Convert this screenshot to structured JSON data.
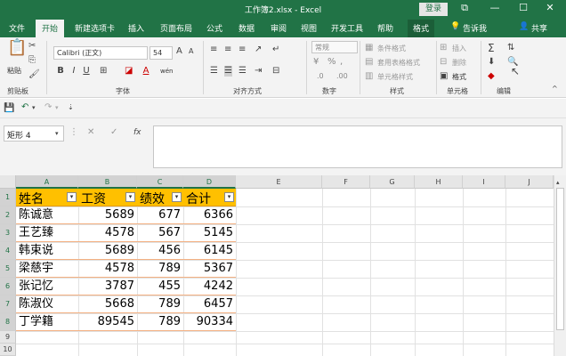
{
  "window": {
    "title": "工作簿2.xlsx  -  Excel",
    "login_label": "登录",
    "restore_glyph": "⧉",
    "minimize_glyph": "—",
    "maximize_glyph": "☐",
    "close_glyph": "✕"
  },
  "tabs": {
    "file": "文件",
    "home": "开始",
    "new_tab": "新建选项卡",
    "insert": "插入",
    "page_layout": "页面布局",
    "formulas": "公式",
    "data": "数据",
    "review": "审阅",
    "view": "视图",
    "developer": "开发工具",
    "help": "帮助",
    "format": "格式",
    "tell_me": "告诉我",
    "share": "共享"
  },
  "ribbon": {
    "paste_label": "粘贴",
    "clipboard_label": "剪贴板",
    "font_name": "Calibri (正文)",
    "font_size": "54",
    "font_group_label": "字体",
    "bold": "B",
    "italic": "I",
    "underline": "U",
    "wen": "wén",
    "alignment_label": "对齐方式",
    "number_format": "常规",
    "number_label": "数字",
    "percent": "%",
    "comma": ",",
    "cond_format": "条件格式",
    "table_format": "套用表格格式",
    "cell_styles": "单元格样式",
    "styles_label": "样式",
    "insert": "插入",
    "delete": "删除",
    "format": "格式",
    "cells_label": "单元格",
    "editing_label": "编辑",
    "sum_glyph": "Σ"
  },
  "formula_bar": {
    "name_box": "矩形 4",
    "cancel_glyph": "✕",
    "enter_glyph": "✓",
    "fx": "fx",
    "formula": ""
  },
  "grid": {
    "columns": [
      "A",
      "B",
      "C",
      "D",
      "E",
      "F",
      "G",
      "H",
      "I",
      "J"
    ],
    "rows": [
      "1",
      "2",
      "3",
      "4",
      "5",
      "6",
      "7",
      "8",
      "9",
      "10"
    ],
    "header": [
      "姓名",
      "工资",
      "绩效",
      "合计"
    ],
    "data": [
      [
        "陈诚意",
        "5689",
        "677",
        "6366"
      ],
      [
        "王艺臻",
        "4578",
        "567",
        "5145"
      ],
      [
        "韩束说",
        "5689",
        "456",
        "6145"
      ],
      [
        "梁慈宇",
        "4578",
        "789",
        "5367"
      ],
      [
        "张记忆",
        "3787",
        "455",
        "4242"
      ],
      [
        "陈淑仪",
        "5668",
        "789",
        "6457"
      ],
      [
        "丁学籍",
        "89545",
        "789",
        "90334"
      ]
    ]
  },
  "colors": {
    "excel_green": "#217346",
    "header_fill": "#ffc000",
    "row_border": "#f4b183"
  }
}
